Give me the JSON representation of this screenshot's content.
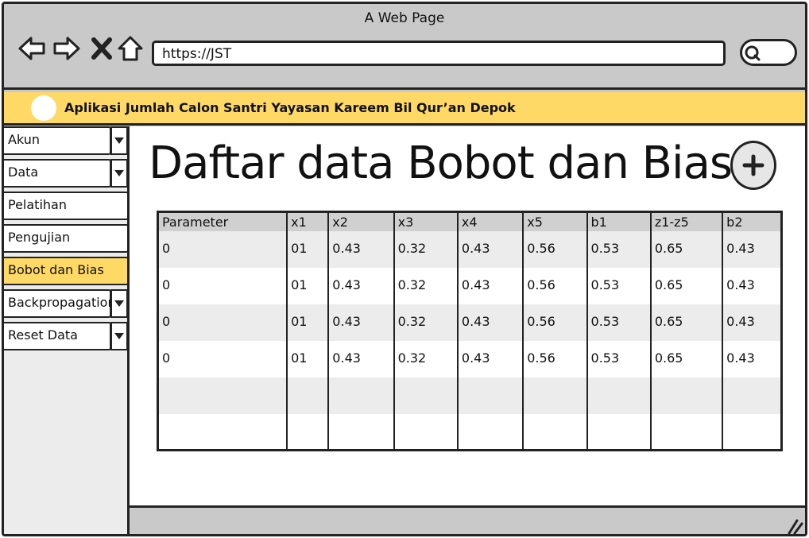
{
  "window": {
    "title": "A Web Page"
  },
  "browser": {
    "url": "https://JST"
  },
  "app": {
    "title": "Aplikasi Jumlah Calon Santri Yayasan Kareem Bil Qur’an Depok"
  },
  "sidebar": {
    "items": [
      {
        "label": "Akun",
        "dropdown": true
      },
      {
        "label": "Data",
        "dropdown": true
      },
      {
        "label": "Pelatihan",
        "dropdown": false
      },
      {
        "label": "Pengujian",
        "dropdown": false
      },
      {
        "label": "Bobot dan Bias",
        "dropdown": false,
        "active": true
      },
      {
        "label": "Backpropagation",
        "dropdown": true
      },
      {
        "label": "Reset Data",
        "dropdown": true
      }
    ]
  },
  "main": {
    "title": "Daftar data Bobot dan Bias",
    "table": {
      "columns": [
        "Parameter",
        "x1",
        "x2",
        "x3",
        "x4",
        "x5",
        "b1",
        "z1-z5",
        "b2"
      ],
      "rows": [
        [
          "0",
          "01",
          "0.43",
          "0.32",
          "0.43",
          "0.56",
          "0.53",
          "0.65",
          "0.43"
        ],
        [
          "0",
          "01",
          "0.43",
          "0.32",
          "0.43",
          "0.56",
          "0.53",
          "0.65",
          "0.43"
        ],
        [
          "0",
          "01",
          "0.43",
          "0.32",
          "0.43",
          "0.56",
          "0.53",
          "0.65",
          "0.43"
        ],
        [
          "0",
          "01",
          "0.43",
          "0.32",
          "0.43",
          "0.56",
          "0.53",
          "0.65",
          "0.43"
        ],
        [
          "",
          "",
          "",
          "",
          "",
          "",
          "",
          "",
          ""
        ],
        [
          "",
          "",
          "",
          "",
          "",
          "",
          "",
          "",
          ""
        ]
      ]
    }
  },
  "colors": {
    "accent": "#ffd966",
    "chrome": "#c9c9c9",
    "border": "#222222"
  },
  "icons": [
    "back-arrow-icon",
    "forward-arrow-icon",
    "close-icon",
    "home-icon",
    "search-icon",
    "plus-icon",
    "resize-grip-icon"
  ]
}
